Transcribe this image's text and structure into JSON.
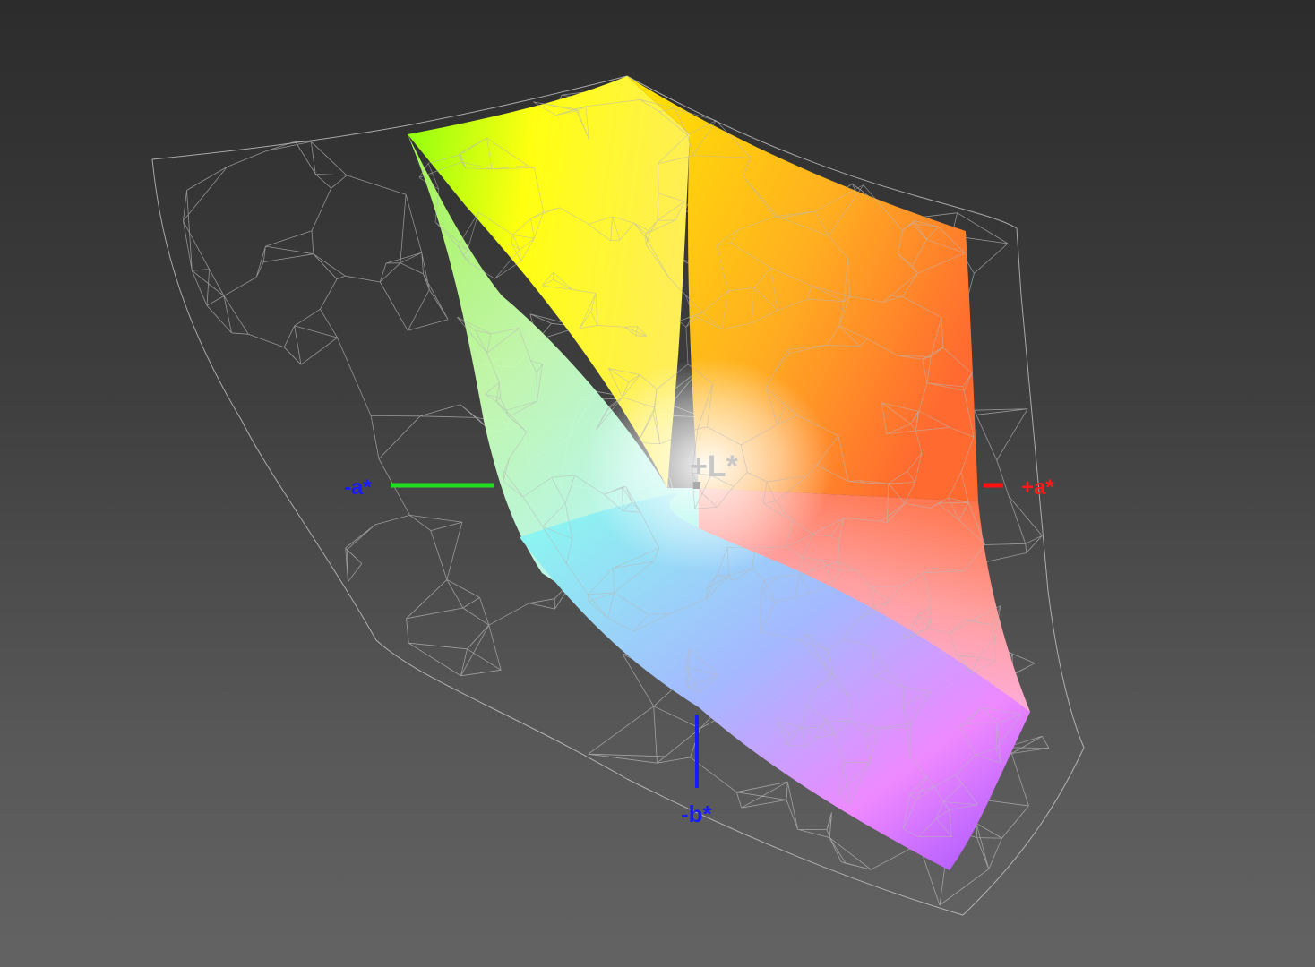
{
  "axes": {
    "L_plus": {
      "label": "+L*",
      "color": "#c8c8c8"
    },
    "a_minus": {
      "label": "-a*",
      "color": "#1a1aff",
      "line_color": "#22dd22"
    },
    "a_plus": {
      "label": "+a*",
      "color": "#ff1a1a",
      "line_color": "#ff1010"
    },
    "b_minus": {
      "label": "-b*",
      "color": "#1a1aff",
      "line_color": "#1a1aff"
    }
  },
  "gamut_colors": {
    "yellow": "#ffff00",
    "green": "#88ff00",
    "orange": "#ff7a2a",
    "red_magenta": "#ff3377",
    "magenta": "#ff44ff",
    "violet": "#9944ff",
    "blue": "#88aaff",
    "cyan": "#66ffee",
    "white": "#ffffff"
  },
  "wireframe_color": "#d0d0d0"
}
